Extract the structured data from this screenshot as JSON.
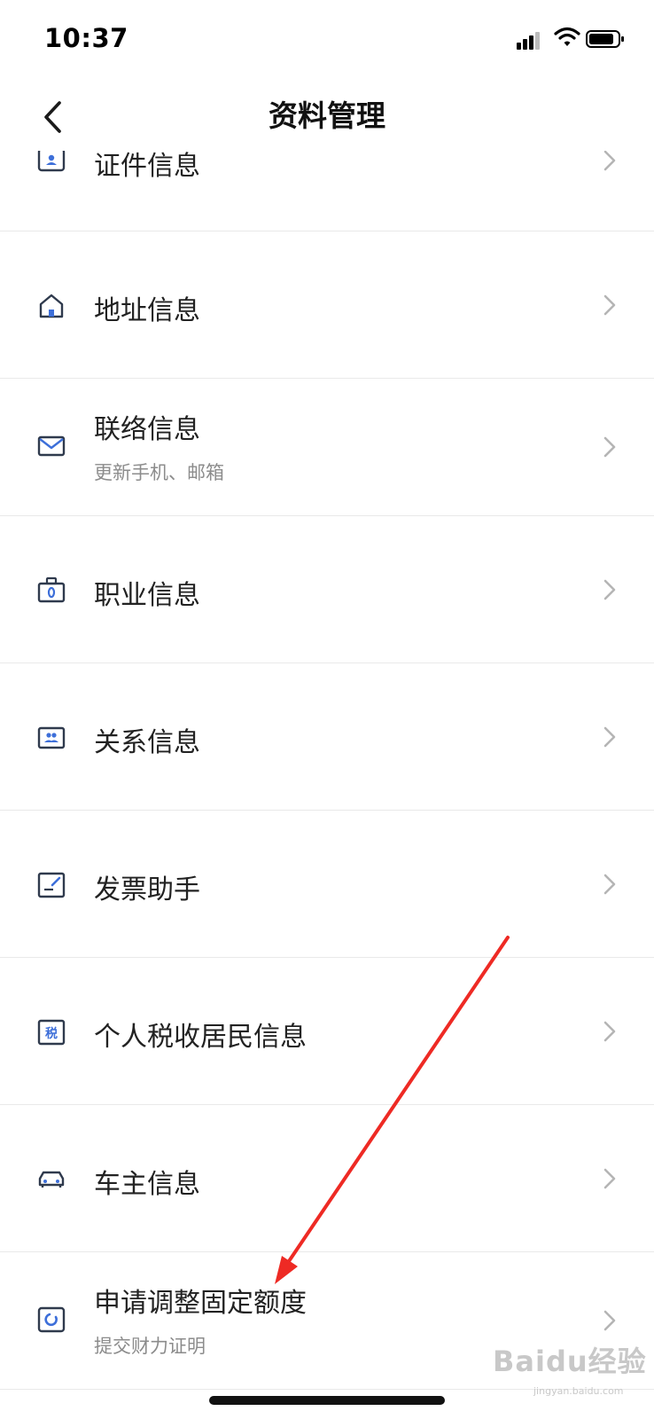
{
  "status_bar": {
    "time": "10:37"
  },
  "nav": {
    "title": "资料管理"
  },
  "items": [
    {
      "label": "证件信息",
      "icon": "id-card-icon"
    },
    {
      "label": "地址信息",
      "icon": "home-icon"
    },
    {
      "label": "联络信息",
      "sub": "更新手机、邮箱",
      "icon": "mail-icon"
    },
    {
      "label": "职业信息",
      "icon": "badge-icon"
    },
    {
      "label": "关系信息",
      "icon": "contacts-icon"
    },
    {
      "label": "发票助手",
      "icon": "invoice-icon"
    },
    {
      "label": "个人税收居民信息",
      "icon": "tax-icon",
      "icon_text": "税"
    },
    {
      "label": "车主信息",
      "icon": "car-icon"
    },
    {
      "label": "申请调整固定额度",
      "sub": "提交财力证明",
      "icon": "limit-icon"
    }
  ],
  "watermark": {
    "brand": "Baidu经验",
    "url": "jingyan.baidu.com"
  },
  "colors": {
    "icon_stroke": "#2f3a4d",
    "icon_accent": "#3d6fd9",
    "arrow": "#ee2a24"
  }
}
